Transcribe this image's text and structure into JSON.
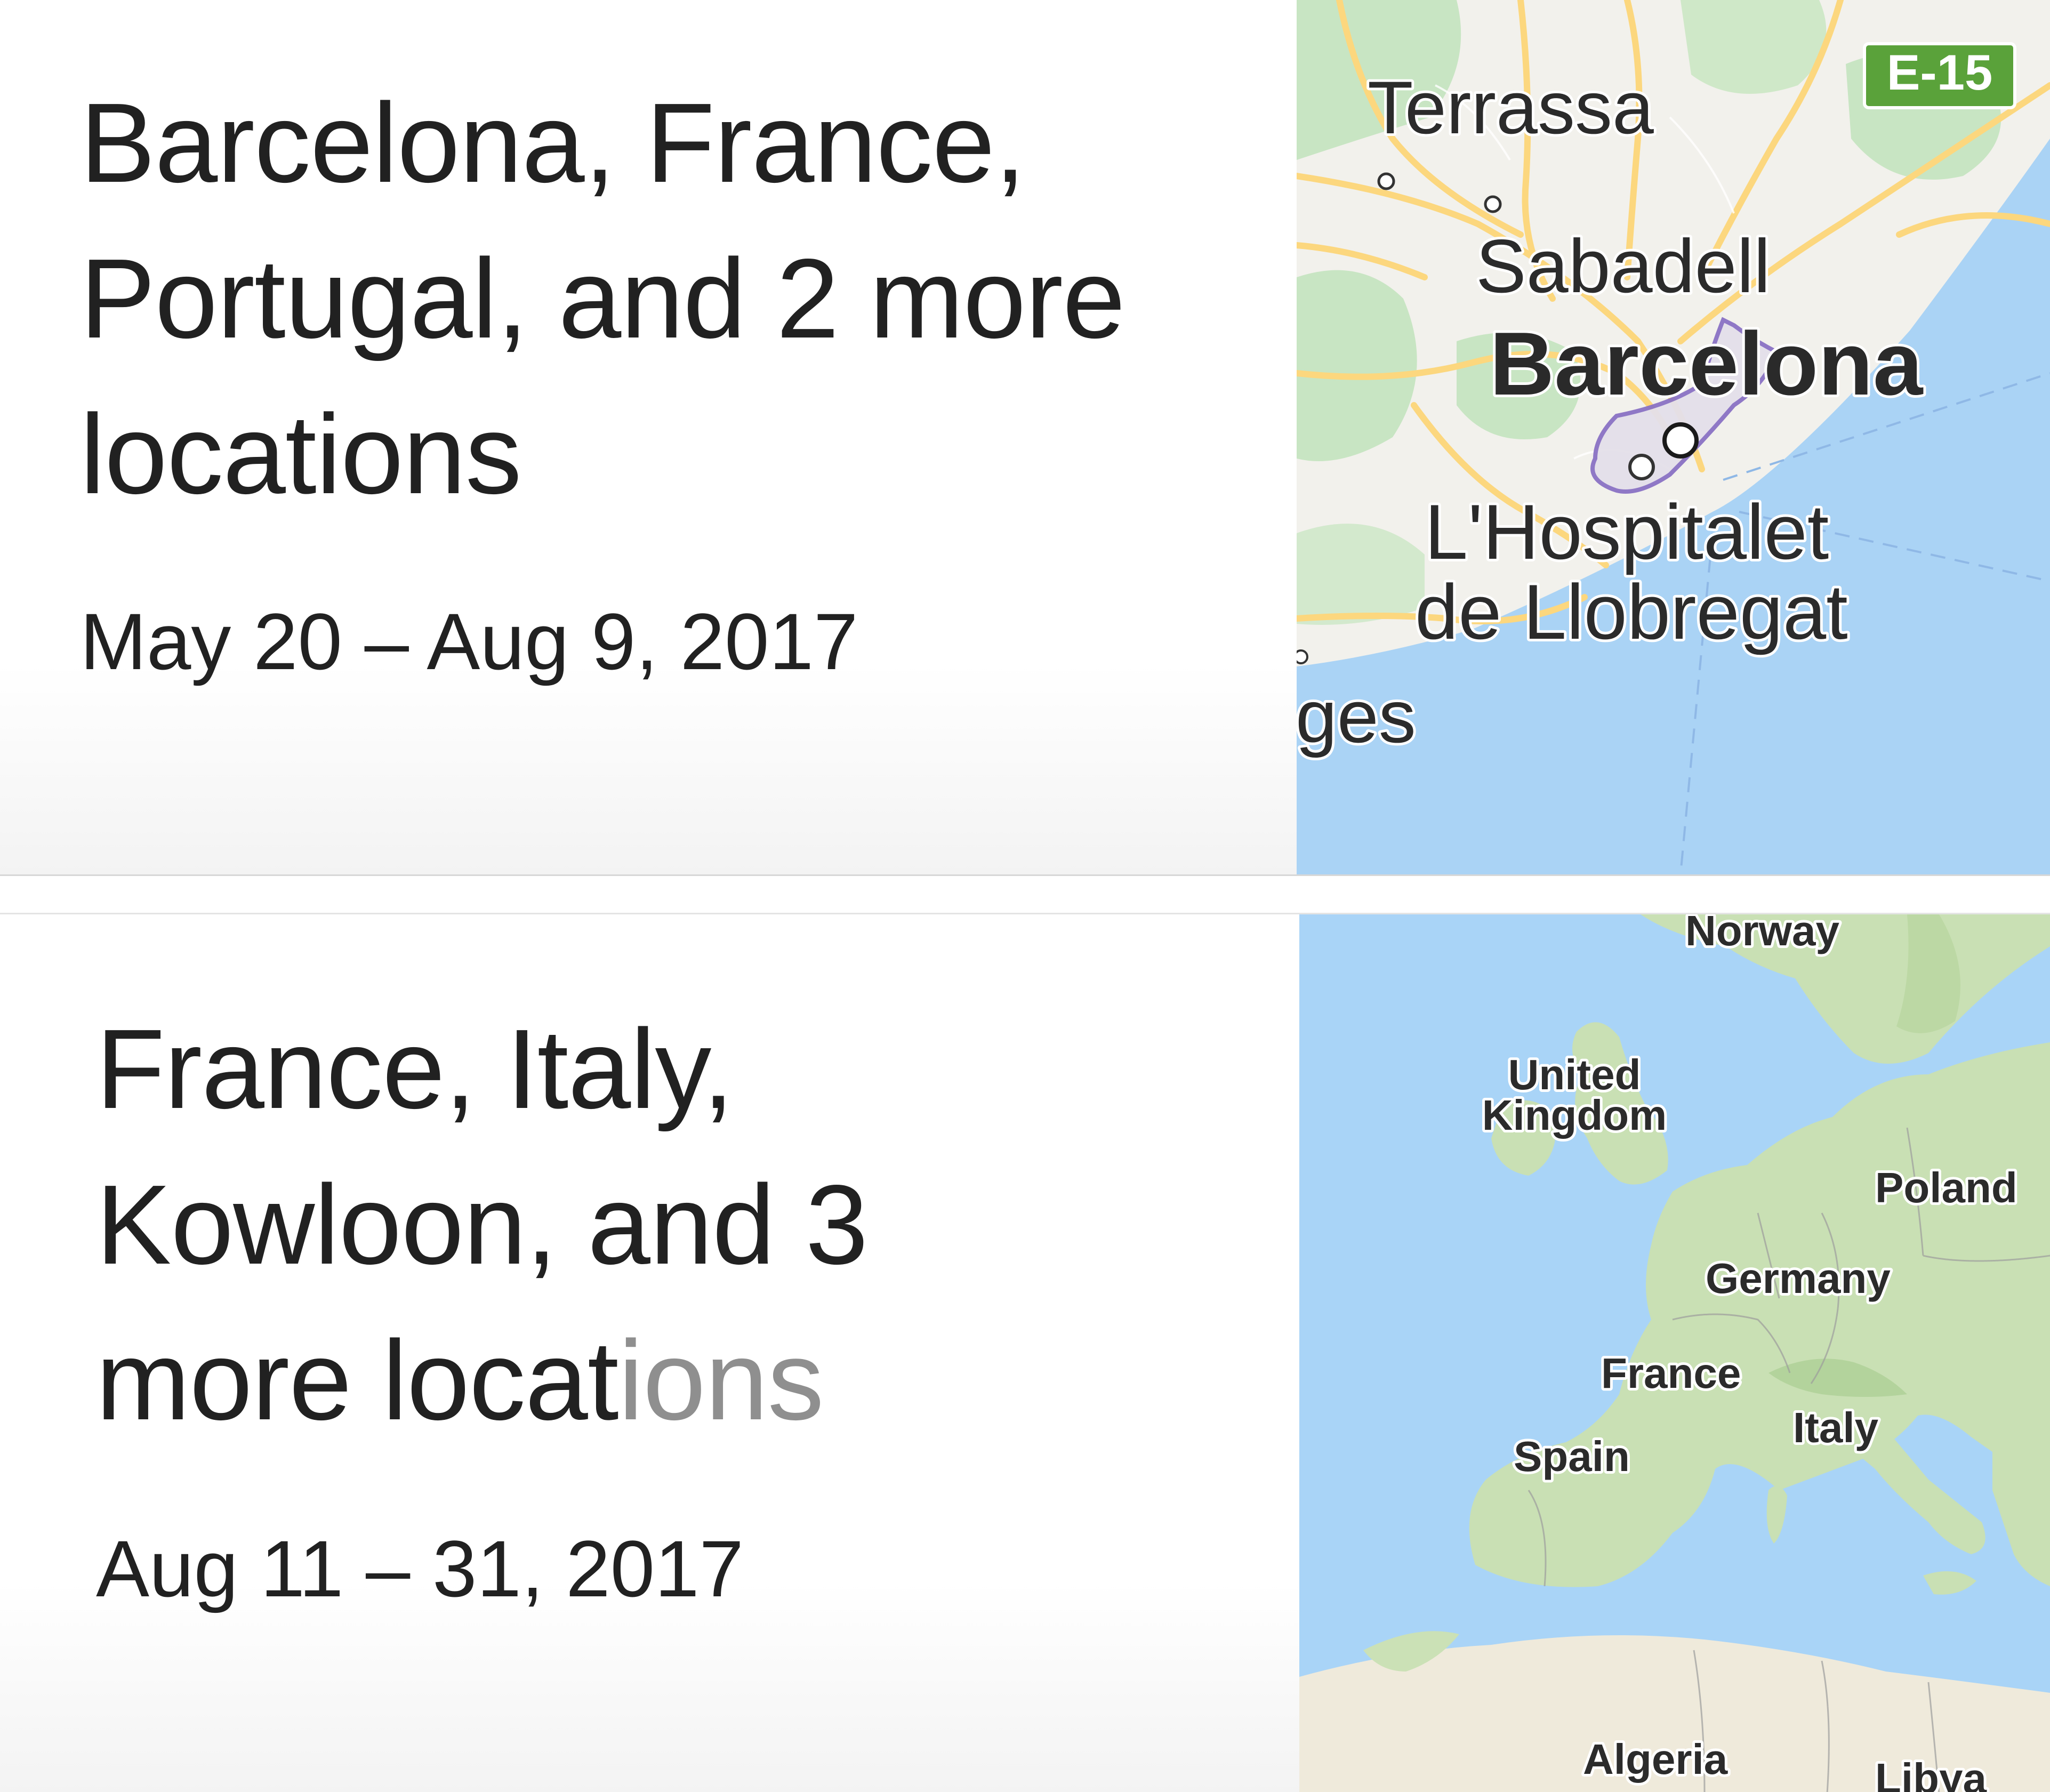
{
  "trips": [
    {
      "title": "Barcelona, France, Portugal, and 2 more locations",
      "dates": "May 20 – Aug 9, 2017",
      "map": {
        "road_badge": "E-15",
        "labels": {
          "terrassa": "Terrassa",
          "sabadell": "Sabadell",
          "barcelona": "Barcelona",
          "hospitalet_line1": "L'Hospitalet",
          "hospitalet_line2": "de Llobregat",
          "partial": "ges"
        },
        "colors": {
          "land": "#f2f1ec",
          "green": "#c8e5c3",
          "water": "#aad3f5",
          "roads": "#fcd77e",
          "boundary": "#8a72c4",
          "badge": "#5aa23a"
        }
      }
    },
    {
      "title_main": "France, Italy, Kowloon, and 3 more locat",
      "title_faded": "ions",
      "dates": "Aug 11 – 31, 2017",
      "map": {
        "labels": {
          "norway": "Norway",
          "uk_line1": "United",
          "uk_line2": "Kingdom",
          "poland": "Poland",
          "germany": "Germany",
          "france": "France",
          "italy": "Italy",
          "spain": "Spain",
          "algeria": "Algeria",
          "libya": "Libya"
        },
        "colors": {
          "water": "#a9d4f7",
          "land": "#c9e0b4",
          "desert": "#efeadb"
        }
      }
    }
  ]
}
